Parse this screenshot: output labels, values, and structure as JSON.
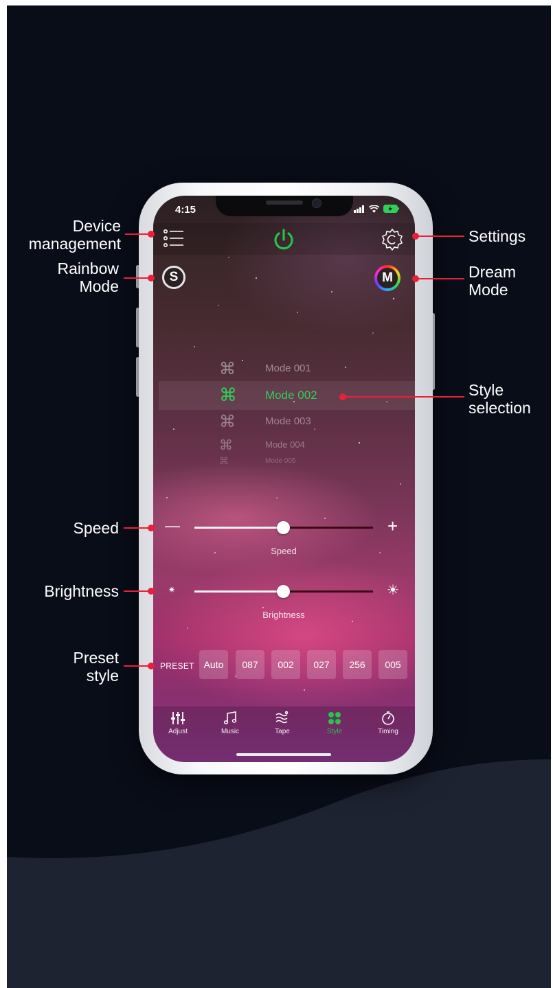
{
  "status_bar": {
    "time": "4:15"
  },
  "header": {
    "device_menu_icon": "list-icon",
    "power_icon": "power-icon",
    "power_color": "#27c24c",
    "settings_icon": "gear-icon"
  },
  "mode_buttons": {
    "rainbow_letter": "S",
    "dream_letter": "M"
  },
  "style_list": {
    "items": [
      "Mode 001",
      "Mode 002",
      "Mode 003",
      "Mode 004",
      "Mode 005"
    ],
    "selected": "Mode 002",
    "selected_color": "#2fcf58"
  },
  "speed": {
    "label": "Speed",
    "minus": "—",
    "plus": "+",
    "value_fraction": 0.5
  },
  "brightness": {
    "label": "Brightness",
    "value_fraction": 0.5
  },
  "preset": {
    "label": "PRESET",
    "chips": [
      "Auto",
      "087",
      "002",
      "027",
      "256",
      "005"
    ]
  },
  "tabs": [
    {
      "label": "Adjust",
      "icon": "sliders-icon"
    },
    {
      "label": "Music",
      "icon": "music-note-icon"
    },
    {
      "label": "Tape",
      "icon": "tape-icon"
    },
    {
      "label": "Style",
      "icon": "style-icon",
      "active": true
    },
    {
      "label": "Timing",
      "icon": "timer-icon"
    }
  ],
  "active_tab_color": "#2fbf50",
  "accent_red": "#e8203a",
  "callouts": {
    "device_management": [
      "Device",
      "management"
    ],
    "rainbow_mode": [
      "Rainbow",
      "Mode"
    ],
    "settings": [
      "Settings"
    ],
    "dream_mode": [
      "Dream",
      "Mode"
    ],
    "style_selection": [
      "Style",
      "selection"
    ],
    "speed": [
      "Speed"
    ],
    "brightness": [
      "Brightness"
    ],
    "preset_style": [
      "Preset",
      "style"
    ]
  }
}
